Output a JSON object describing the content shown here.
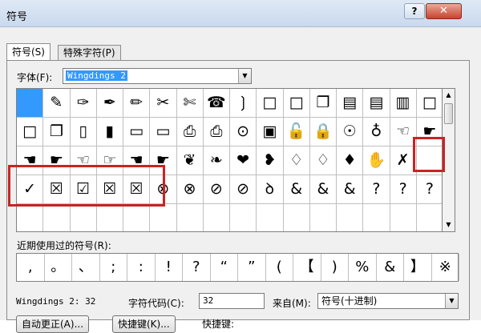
{
  "window": {
    "title": "符号",
    "help_glyph": "?",
    "close_glyph": "✕"
  },
  "tabs": [
    {
      "label": "符号(S)",
      "active": true
    },
    {
      "label": "特殊字符(P)",
      "active": false
    }
  ],
  "font": {
    "label": "字体(F):",
    "value": "Wingdings 2"
  },
  "symbols": [
    [
      "■",
      "✎",
      "✑",
      "✒",
      "✏",
      "✂",
      "✄",
      "☎",
      "❳",
      "□",
      "□",
      "❐",
      "▤",
      "▤",
      "▥",
      "□"
    ],
    [
      "□",
      "❐",
      "▯",
      "▮",
      "▭",
      "▭",
      "⎙",
      "⎙",
      "⊙",
      "▣",
      "🔓",
      "🔒",
      "☉",
      "♁",
      "☜",
      "☛"
    ],
    [
      "☚",
      "☛",
      "☜",
      "☞",
      "☚",
      "☛",
      "❦",
      "❧",
      "❤",
      "❥",
      "♢",
      "♢",
      "♦",
      "✋",
      "✗",
      ""
    ],
    [
      "✓",
      "☒",
      "☑",
      "☒",
      "☒",
      "⊗",
      "⊗",
      "⊘",
      "⊘",
      "ꝺ",
      "&",
      "&",
      "&",
      "?",
      "?",
      "?"
    ]
  ],
  "selected_index": 0,
  "icon_names": {
    "check": "check-mark-icon",
    "ballot_x": "ballot-x-icon",
    "ballot_check": "ballot-check-icon",
    "x_mark": "x-mark-icon"
  },
  "recent": {
    "label": "近期使用过的符号(R):",
    "items": [
      ",",
      "。",
      "、",
      ";",
      ":",
      "!",
      "?",
      "“",
      "”",
      "(",
      "【",
      ")",
      "%",
      "&",
      "】",
      "※"
    ]
  },
  "status": {
    "font_code": "Wingdings 2: 32",
    "char_code_label": "字符代码(C):",
    "char_code_value": "32",
    "from_label": "来自(M):",
    "from_value": "符号(十进制)"
  },
  "buttons": {
    "autocorrect": "自动更正(A)...",
    "shortcut_key": "快捷键(K)...",
    "shortcut_label": "快捷键:"
  },
  "highlight_color": "#cc2222",
  "selection_color": "#3399ff"
}
